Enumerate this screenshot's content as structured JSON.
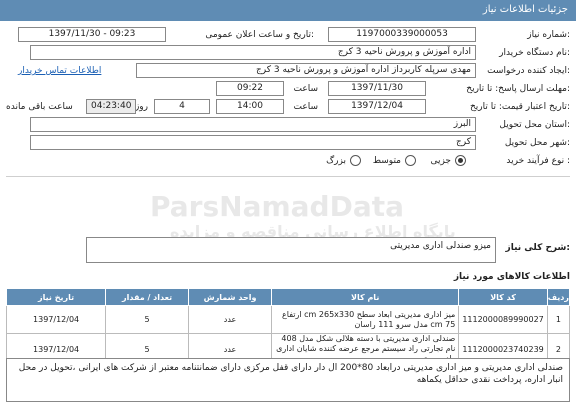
{
  "header": {
    "title": "جزئیات اطلاعات نیاز"
  },
  "need": {
    "number_label": "شماره نیاز:",
    "number_value": "1197000339000053",
    "announce_label": "تاریخ و ساعت اعلان عمومی:",
    "announce_value": "1397/11/30 - 09:23",
    "buyer_label": "نام دستگاه خریدار:",
    "buyer_value": "اداره آموزش و پرورش ناحیه 3 کرج",
    "creator_label": "ایجاد کننده درخواست:",
    "creator_value": "مهدی سرپله کاربرداز اداره آموزش و پرورش ناحیه 3 کرج",
    "contact_link": "اطلاعات تماس خریدار",
    "deadline_label": "مهلت ارسال پاسخ: تا تاریخ:",
    "deadline_date": "1397/11/30",
    "time_label": "ساعت",
    "deadline_time": "09:22",
    "validity_label": "تاریخ اعتبار قیمت: تا تاریخ:",
    "validity_date": "1397/12/04",
    "validity_time_label": "ساعت",
    "validity_time": "14:00",
    "days_value": "4",
    "days_label": "روز و",
    "remaining_value": "04:23:40",
    "remaining_label": "ساعت باقی مانده",
    "province_label": "استان محل تحویل:",
    "province_value": "البرز",
    "city_label": "شهر محل تحویل:",
    "city_value": "کرج",
    "purchase_type_label": "نوع فرآیند خرید :",
    "opt_partial": "جزیی",
    "opt_medium": "متوسط",
    "opt_large": "بزرگ"
  },
  "summary": {
    "label": "شرح کلی نیاز:",
    "value": "میزو صندلی اداری مدیریتی"
  },
  "items": {
    "section_title": "اطلاعات کالاهای مورد نیاز",
    "columns": [
      "ردیف",
      "کد کالا",
      "نام کالا",
      "واحد شمارش",
      "تعداد / مقدار",
      "تاریخ نیاز"
    ],
    "rows": [
      {
        "row": "1",
        "code": "1112000089990027",
        "name": "میز اداری مدیریتی ابعاد سطح cm 265x330 ارتفاع cm 75 مدل سرو 111 راسان",
        "unit": "عدد",
        "qty": "5",
        "date": "1397/12/04"
      },
      {
        "row": "2",
        "code": "1112000023740239",
        "name": "صندلی اداری مدیریتی با دسته هلالی شکل مدل 408 نام تجارتی راد سیستم مرجع عرضه کننده شایان اداری راد سیستم",
        "unit": "عدد",
        "qty": "5",
        "date": "1397/12/04"
      }
    ]
  },
  "notes": {
    "text": "صندلی اداری مدیریتی و میز اداری مدیریتی درابعاد 80*200 ال دار دارای قفل مرکزی دارای ضمانتنامه معتبر از شرکت های ایرانی ،تحویل در محل انبار اداره، پرداخت نقدی حداقل یکماهه"
  },
  "watermark": {
    "line1": "ParsNamadData",
    "line2": "پایگاه اطلاع رسانی مناقصه و مزایده"
  },
  "colors": {
    "header_bg": "#5f8cb4",
    "link": "#1a5fb4"
  }
}
